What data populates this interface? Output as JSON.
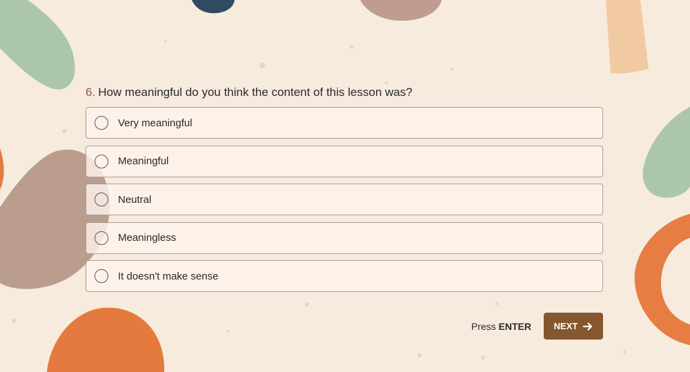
{
  "question": {
    "number": "6.",
    "text": "How meaningful do you think the content of this lesson was?"
  },
  "options": [
    {
      "label": "Very meaningful"
    },
    {
      "label": "Meaningful"
    },
    {
      "label": "Neutral"
    },
    {
      "label": "Meaningless"
    },
    {
      "label": "It doesn't make sense"
    }
  ],
  "footer": {
    "hint_prefix": "Press",
    "hint_key": "ENTER",
    "next_label": "NEXT"
  },
  "colors": {
    "background": "#f7ebde",
    "accent": "#86572f",
    "question_number": "#8a5a3a"
  }
}
